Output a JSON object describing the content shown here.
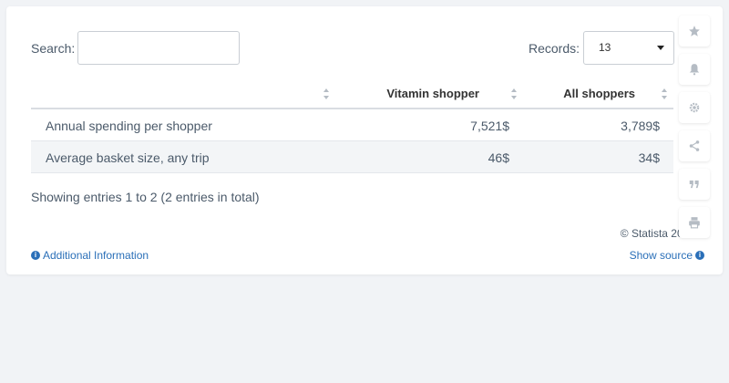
{
  "controls": {
    "search_label": "Search:",
    "search_value": "",
    "records_label": "Records:",
    "records_value": "13"
  },
  "table": {
    "headers": [
      "",
      "Vitamin shopper",
      "All shoppers"
    ],
    "rows": [
      {
        "label": "Annual spending per shopper",
        "vitamin": "7,521$",
        "all": "3,789$"
      },
      {
        "label": "Average basket size, any trip",
        "vitamin": "46$",
        "all": "34$"
      }
    ]
  },
  "footer": {
    "entries_text": "Showing entries 1 to 2 (2 entries in total)",
    "copyright": "© Statista 2021",
    "additional_info": "Additional Information",
    "show_source": "Show source"
  },
  "side_tools": [
    "star-icon",
    "bell-icon",
    "gear-icon",
    "share-icon",
    "quote-icon",
    "print-icon"
  ],
  "colors": {
    "link": "#2a6fb8",
    "icon_gray": "#b5bcc4"
  }
}
